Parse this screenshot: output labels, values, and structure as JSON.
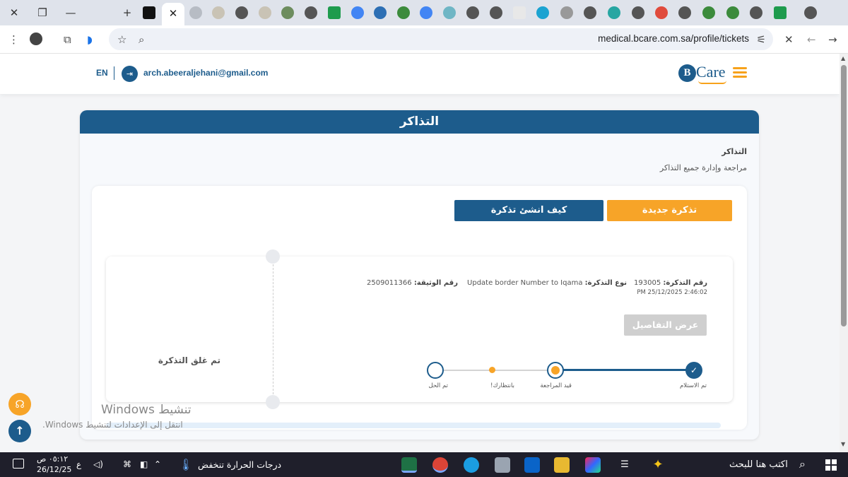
{
  "browser": {
    "active_tab_close": "✕",
    "url": "medical.bcare.com.sa/profile/tickets"
  },
  "header": {
    "lang": "EN",
    "email": "arch.abeeraljehani@gmail.com",
    "logo_initial": "B",
    "logo_text": "Care"
  },
  "panel": {
    "title": "التذاكر",
    "breadcrumb_title": "التذاكر",
    "breadcrumb_subtitle": "مراجعة وإدارة جميع التذاكر"
  },
  "actions": {
    "new_ticket": "تذكرة جديدة",
    "how_to_create": "كيف انشئ تذكرة"
  },
  "ticket": {
    "number_label": "رقم التذكرة:",
    "number": "193005",
    "datetime": "PM 25/12/2025 2:46:02",
    "type_label": "نوع التذكرة:",
    "type": "Update border Number to Iqama",
    "document_label": "رقم الوثيقة:",
    "document": "2509011366",
    "details_button": "عرض التفاصيل",
    "closed_status": "تم غلق التذكرة",
    "statuses": [
      "تم الاستلام",
      "قيد المراجعة",
      "بانتظارك!",
      "تم الحل"
    ]
  },
  "overlay": {
    "watermark_title": "تنشيط Windows",
    "watermark_sub": "انتقل إلى الإعدادات لتنشيط Windows."
  },
  "taskbar": {
    "search_placeholder": "اكتب هنا للبحث",
    "weather": "درجات الحرارة تنخفض",
    "time": "٠٥:١٢ ص",
    "date": "26/12/25",
    "lang_indicator": "ع"
  },
  "colors": {
    "brand_blue": "#1d5c8c",
    "accent_orange": "#f7a428",
    "disabled_grey": "#cfcfcf"
  }
}
